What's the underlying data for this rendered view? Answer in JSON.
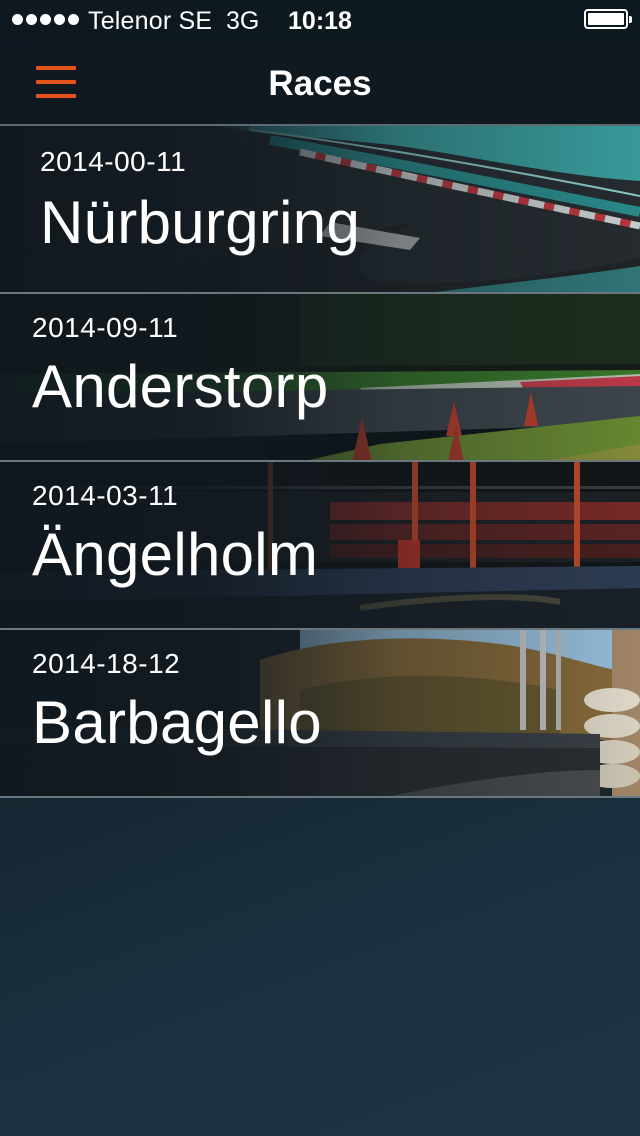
{
  "status_bar": {
    "signal_dots": 5,
    "carrier": "Telenor SE",
    "network": "3G",
    "time": "10:18",
    "battery_level": 1.0
  },
  "nav_bar": {
    "title": "Races",
    "menu_icon": "hamburger-menu-icon",
    "accent_color": "#e4531b"
  },
  "races": [
    {
      "date": "2014-00-11",
      "name": "Nürburgring",
      "photo": "curved race track with teal runoff and red-white kerbs"
    },
    {
      "date": "2014-09-11",
      "name": "Anderstorp",
      "photo": "track edge with traffic cones and grass"
    },
    {
      "date": "2014-03-11",
      "name": "Ängelholm",
      "photo": "grandstand with red seats beside the track"
    },
    {
      "date": "2014-18-12",
      "name": "Barbagello",
      "photo": "tyre barriers and hillside beside the track"
    }
  ]
}
